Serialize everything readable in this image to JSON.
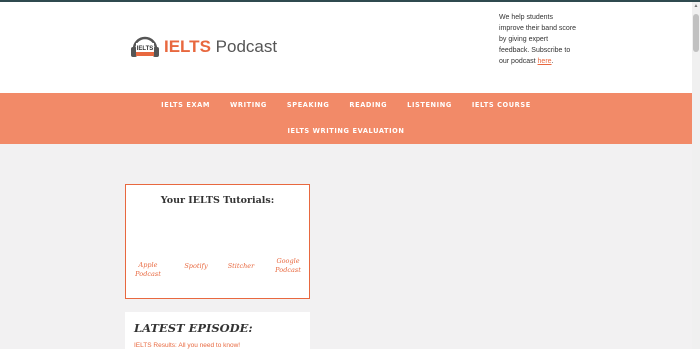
{
  "header": {
    "logo": {
      "mark_text": "IELTS",
      "word_bold": "IELTS",
      "word_rest": " Podcast"
    },
    "tagline": {
      "text": "We help students improve their band score by giving expert feedback. Subscribe to our podcast ",
      "link": "here",
      "end": "."
    }
  },
  "nav": {
    "row1": [
      "IELTS EXAM",
      "WRITING",
      "SPEAKING",
      "READING",
      "LISTENING",
      "IELTS COURSE"
    ],
    "row2": [
      "IELTS WRITING EVALUATION"
    ]
  },
  "tutorials": {
    "title": "Your IELTS Tutorials:",
    "links": {
      "apple": "Apple Podcast",
      "spotify": "Spotify",
      "stitcher": "Stitcher",
      "google": "Google Podcast"
    }
  },
  "latest": {
    "title": "LATEST EPISODE:",
    "link": "IELTS Results: All you need to know!"
  },
  "colors": {
    "accent": "#e8683f",
    "nav_bg": "#f28a68",
    "page_bg": "#f2f1f2"
  },
  "icons": {
    "logo_mark": "headphones-logo-icon"
  }
}
